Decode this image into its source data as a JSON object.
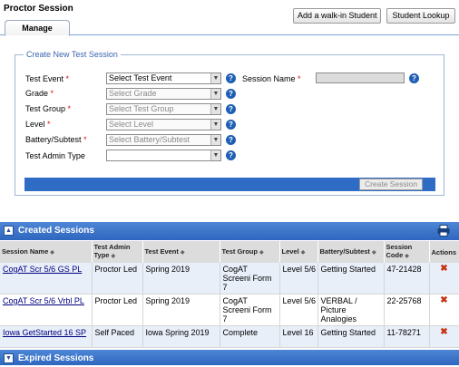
{
  "page": {
    "title": "Proctor Session",
    "buttons": {
      "add_walkin": "Add a walk-in Student",
      "lookup": "Student Lookup"
    },
    "tabs": [
      "Manage"
    ]
  },
  "create_form": {
    "legend": "Create New Test Session",
    "help_glyph": "?",
    "required_mark": "*",
    "fields": {
      "test_event": {
        "label": "Test Event",
        "value": "Select Test Event"
      },
      "session_name": {
        "label": "Session Name",
        "value": ""
      },
      "grade": {
        "label": "Grade",
        "value": "Select Grade"
      },
      "test_group": {
        "label": "Test Group",
        "value": "Select Test Group"
      },
      "level": {
        "label": "Level",
        "value": "Select Level"
      },
      "battery": {
        "label": "Battery/Subtest",
        "value": "Select Battery/Subtest"
      },
      "admin_type": {
        "label": "Test Admin Type",
        "value": ""
      }
    },
    "create_button": "Create Session"
  },
  "created_sessions": {
    "title": "Created Sessions",
    "columns": [
      "Session Name",
      "Test Admin Type",
      "Test Event",
      "Test Group",
      "Level",
      "Battery/Subtest",
      "Session Code",
      "Actions"
    ],
    "rows": [
      {
        "name": "CogAT Scr 5/6 GS PL",
        "admin": "Proctor Led",
        "event": "Spring 2019",
        "group": "CogAT Screeni Form 7",
        "level": "Level 5/6",
        "battery": "Getting Started",
        "code": "47-21428"
      },
      {
        "name": "CogAT Scr 5/6 Vrbl PL",
        "admin": "Proctor Led",
        "event": "Spring 2019",
        "group": "CogAT Screeni Form 7",
        "level": "Level 5/6",
        "battery": "VERBAL / Picture Analogies",
        "code": "22-25768"
      },
      {
        "name": "Iowa GetStarted 16 SP",
        "admin": "Self Paced",
        "event": "Iowa Spring 2019",
        "group": "Complete",
        "level": "Level 16",
        "battery": "Getting Started",
        "code": "11-78271"
      }
    ],
    "delete_glyph": "✖",
    "sort_glyph": "◆"
  },
  "expired_sessions": {
    "title": "Expired Sessions"
  },
  "colors": {
    "header_blue": "#2d66be",
    "required_red": "#dd1111",
    "delete_red": "#c8320f"
  },
  "icons": [
    "question-icon",
    "dropdown-arrow-icon",
    "collapse-icon",
    "printer-icon",
    "delete-icon",
    "sort-icon"
  ]
}
